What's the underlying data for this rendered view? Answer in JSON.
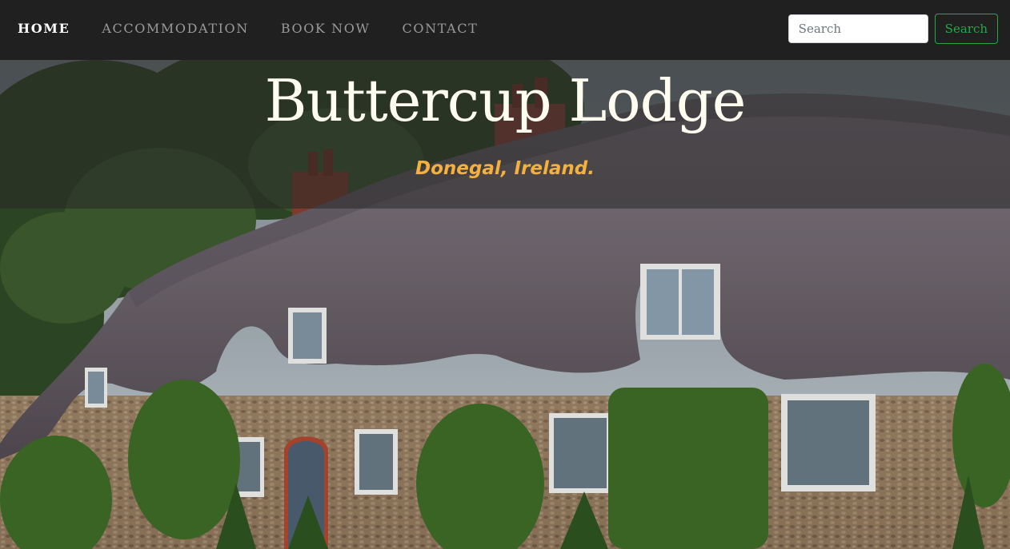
{
  "nav": {
    "items": [
      {
        "label": "HOME",
        "active": true
      },
      {
        "label": "ACCOMMODATION",
        "active": false
      },
      {
        "label": "BOOK NOW",
        "active": false
      },
      {
        "label": "CONTACT",
        "active": false
      }
    ],
    "search": {
      "placeholder": "Search",
      "button_label": "Search"
    }
  },
  "hero": {
    "title": "Buttercup Lodge",
    "subtitle": "Donegal, Ireland."
  },
  "colors": {
    "navbar_bg": "#202020",
    "search_button": "#28a745",
    "subtitle": "#f4b13e"
  }
}
